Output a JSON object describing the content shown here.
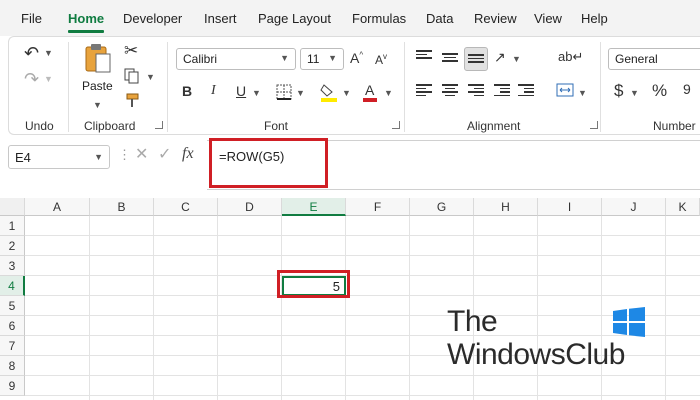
{
  "tabs": [
    "File",
    "Home",
    "Developer",
    "Insert",
    "Page Layout",
    "Formulas",
    "Data",
    "Review",
    "View",
    "Help"
  ],
  "ribbon": {
    "groups": [
      "Undo",
      "Clipboard",
      "Font",
      "Alignment",
      "Number"
    ],
    "paste_label": "Paste",
    "font_name": "Calibri",
    "font_size": "11",
    "number_format": "General"
  },
  "formula_bar": {
    "name_box": "E4",
    "formula": "=ROW(G5)"
  },
  "sheet": {
    "columns": [
      "A",
      "B",
      "C",
      "D",
      "E",
      "F",
      "G",
      "H",
      "I",
      "J",
      "K"
    ],
    "rows": [
      "1",
      "2",
      "3",
      "4",
      "5",
      "6",
      "7",
      "8",
      "9"
    ],
    "selected_cell": "E4",
    "selected_value": "5"
  },
  "watermark": {
    "line1": "The",
    "line2": "WindowsClub"
  },
  "colors": {
    "accent": "#107c41",
    "highlight": "#d01f25"
  }
}
